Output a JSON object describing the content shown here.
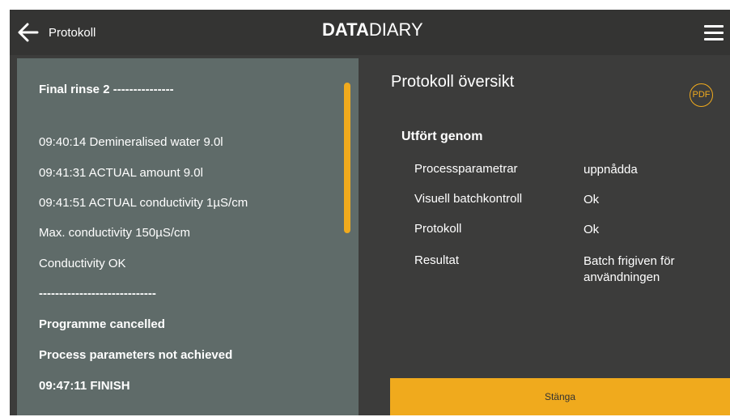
{
  "header": {
    "back_label": "Protokoll",
    "brand_bold": "DATA",
    "brand_light": "DIARY",
    "icons": {
      "back": "arrow-left-icon",
      "menu": "hamburger-menu-icon"
    }
  },
  "log": {
    "lines": [
      {
        "text": "Final rinse 2 ---------------",
        "bold": true
      },
      {
        "text": "09:40:14 Demineralised water 9.0l",
        "bold": false
      },
      {
        "text": "09:41:31 ACTUAL amount 9.0l",
        "bold": false
      },
      {
        "text": "09:41:51 ACTUAL conductivity 1µS/cm",
        "bold": false
      },
      {
        "text": "Max. conductivity 150µS/cm",
        "bold": false
      },
      {
        "text": "Conductivity OK",
        "bold": false
      },
      {
        "text": "-----------------------------",
        "bold": true
      },
      {
        "text": "Programme cancelled",
        "bold": true
      },
      {
        "text": "Process parameters not achieved",
        "bold": true
      },
      {
        "text": "09:47:11 FINISH",
        "bold": true
      }
    ]
  },
  "overview": {
    "title": "Protokoll översikt",
    "pdf_label": "PDF",
    "section": "Utfört genom",
    "rows": [
      {
        "label": "Processparametrar",
        "value": "uppnådda"
      },
      {
        "label": "Visuell batchkontroll",
        "value": "Ok"
      },
      {
        "label": "Protokoll",
        "value": "Ok"
      },
      {
        "label": "Resultat",
        "value": "Batch frigiven för användningen"
      }
    ]
  },
  "actions": {
    "close_label": "Stänga"
  },
  "colors": {
    "accent": "#f0aa1d",
    "background": "#3c3c3b",
    "topbar": "#343433",
    "log_panel": "#5f6b69",
    "text": "#ffffff"
  }
}
